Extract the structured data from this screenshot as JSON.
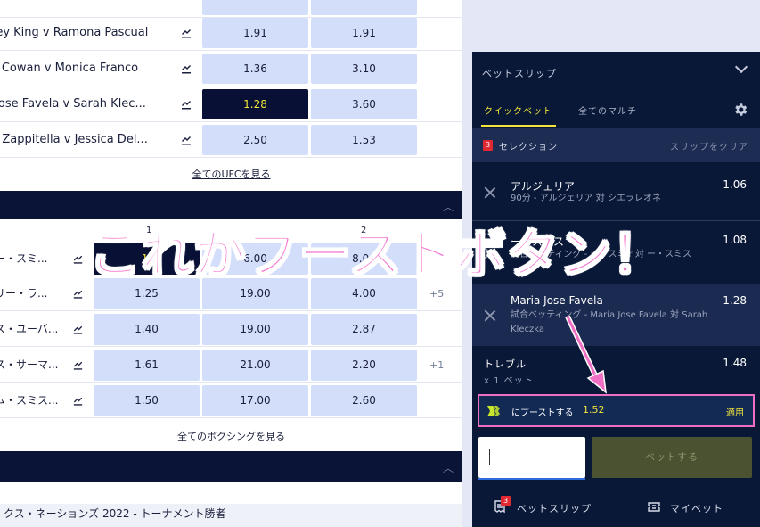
{
  "ufc": {
    "fights": [
      {
        "name": "tney King v Ramona Pascual",
        "odds": [
          "1.91",
          "1.91"
        ],
        "selected": -1
      },
      {
        "name": "ey Cowan v Monica Franco",
        "odds": [
          "1.36",
          "3.10"
        ],
        "selected": -1
      },
      {
        "name": "a Jose Favela v Sarah Klec...",
        "odds": [
          "1.28",
          "3.60"
        ],
        "selected": 0
      },
      {
        "name": "na Zappitella v Jessica Del...",
        "odds": [
          "2.50",
          "1.53"
        ],
        "selected": -1
      }
    ],
    "see_all": "全てのUFCを見る"
  },
  "boxing": {
    "col_headers": [
      "1",
      "2"
    ],
    "fights": [
      {
        "name": "ー・スミ...",
        "odds": [
          "1.",
          "6.00",
          "8.00"
        ],
        "more": "",
        "selected": 0
      },
      {
        "name": "リー・ラ...",
        "odds": [
          "1.25",
          "19.00",
          "4.00"
        ],
        "more": "+5",
        "selected": -1
      },
      {
        "name": "ス・ユーバ...",
        "odds": [
          "1.40",
          "19.00",
          "2.87"
        ],
        "more": "",
        "selected": -1
      },
      {
        "name": "ス・サーマ...",
        "odds": [
          "1.61",
          "21.00",
          "2.20"
        ],
        "more": "+1",
        "selected": -1
      },
      {
        "name": "ム・スミス...",
        "odds": [
          "1.50",
          "17.00",
          "2.60"
        ],
        "more": "",
        "selected": -1
      }
    ],
    "see_all": "全てのボクシングを見る"
  },
  "outright_label": "クス・ネーションズ 2022 - トーナメント勝者",
  "betslip": {
    "title": "ベットスリップ",
    "tab_quick": "クイックベット",
    "tab_multi": "全てのマルチ",
    "selection_count": "3",
    "selection_label": "セレクション",
    "clear_label": "スリップをクリア",
    "picks": [
      {
        "name": "アルジェリア",
        "odds": "1.06",
        "desc": "90分 - アルジェリア 対 シエラレオネ"
      },
      {
        "name": "ー・スミス",
        "odds": "1.08",
        "desc": "試合ベッティング - ー・スミ r 対 ー・スミス"
      },
      {
        "name": "Maria Jose Favela",
        "odds": "1.28",
        "desc": "試合ベッティング - Maria Jose Favela 対 Sarah Kleczka"
      }
    ],
    "treble_label": "トレブル",
    "treble_sub": "x 1 ベット",
    "treble_odds": "1.48",
    "boost_text": "にブーストする",
    "boost_value": "1.52",
    "boost_apply": "適用",
    "bet_button": "ベットする",
    "footer_slip": "ベットスリップ",
    "footer_slip_badge": "3",
    "footer_mybets": "マイベット"
  },
  "annotation": "これがブーストボタン！",
  "colors": {
    "navy": "#091436",
    "odds_bg": "#d3defb",
    "highlight": "#f2e43a",
    "annotation_pink": "#f57ad0"
  }
}
